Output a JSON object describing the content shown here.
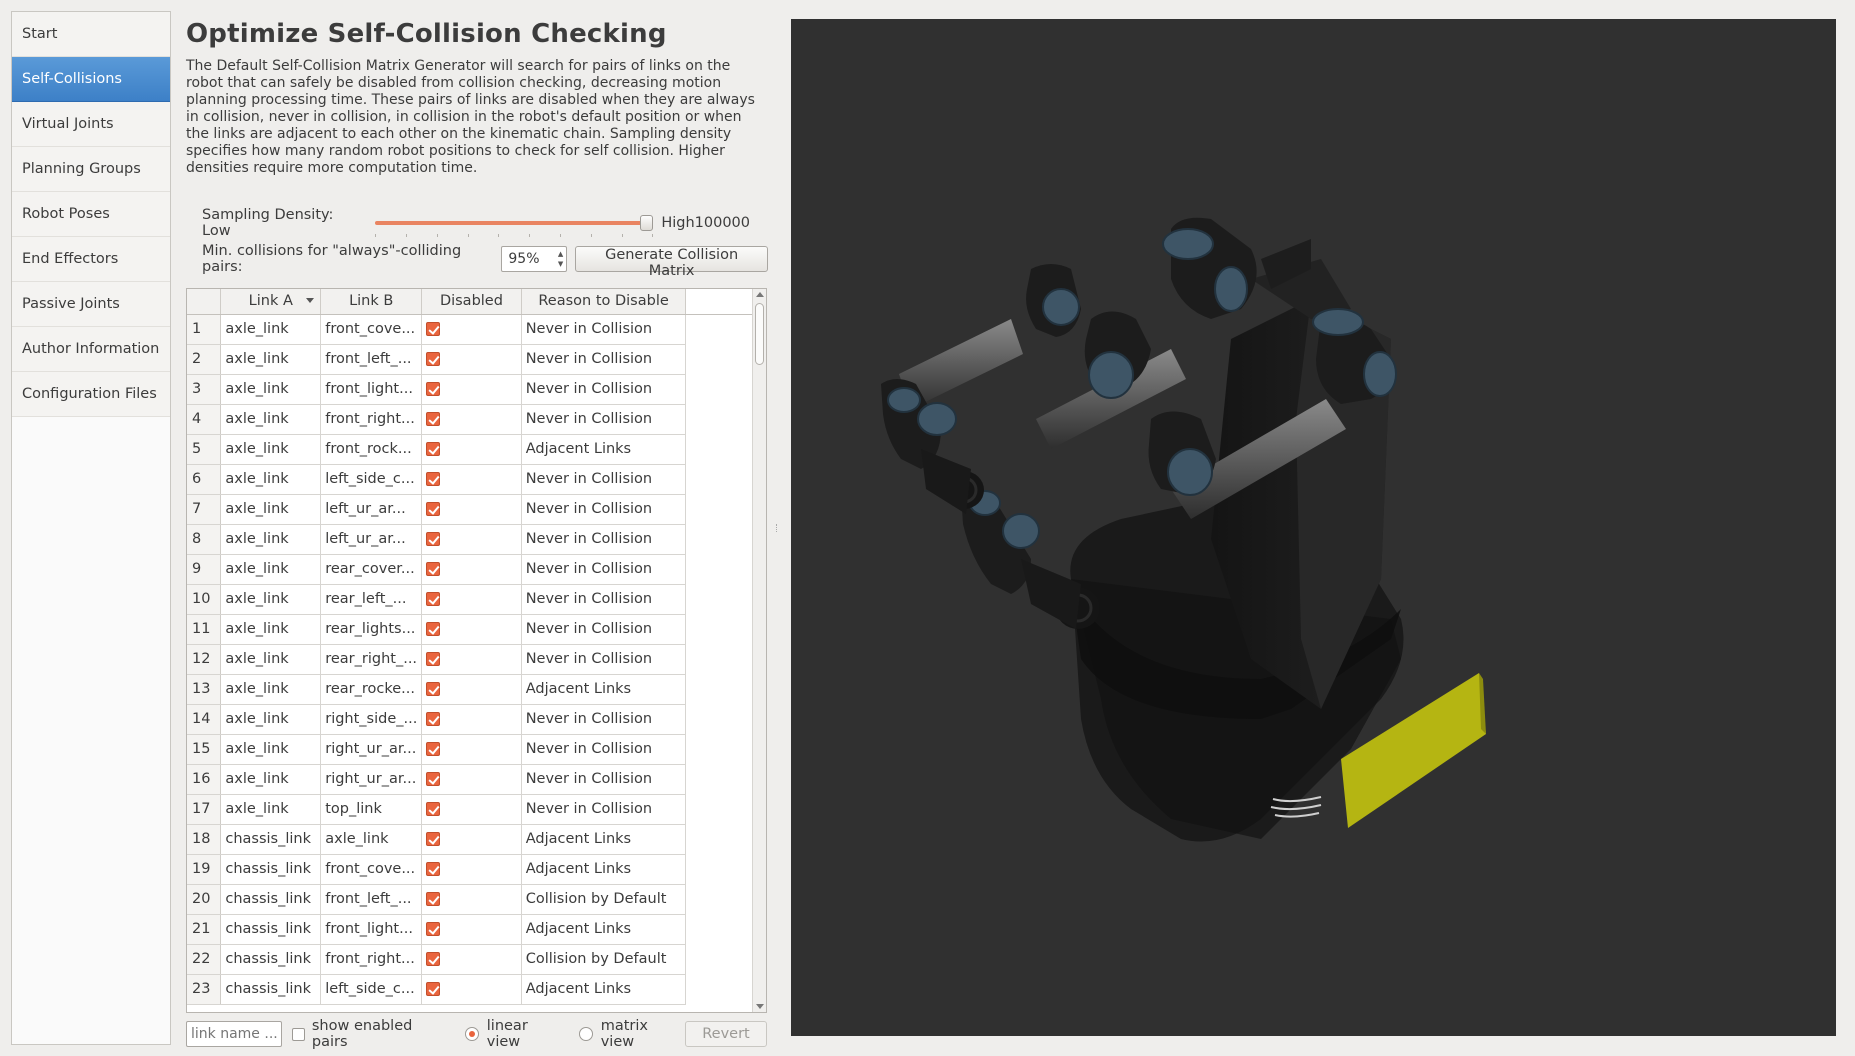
{
  "sidebar": {
    "items": [
      {
        "label": "Start"
      },
      {
        "label": "Self-Collisions"
      },
      {
        "label": "Virtual Joints"
      },
      {
        "label": "Planning Groups"
      },
      {
        "label": "Robot Poses"
      },
      {
        "label": "End Effectors"
      },
      {
        "label": "Passive Joints"
      },
      {
        "label": "Author Information"
      },
      {
        "label": "Configuration Files"
      }
    ],
    "active": "Self-Collisions"
  },
  "main": {
    "title": "Optimize Self-Collision Checking",
    "description": "The Default Self-Collision Matrix Generator will search for pairs of links on the robot that can safely be disabled from collision checking, decreasing motion planning processing time. These pairs of links are disabled when they are always in collision, never in collision, in collision in the robot's default position or when the links are adjacent to each other on the kinematic chain. Sampling density specifies how many random robot positions to check for self collision. Higher densities require more computation time.",
    "density": {
      "label": "Sampling Density: Low",
      "high_label": "High",
      "value": "100000",
      "fraction": 1.0
    },
    "min_collisions": {
      "label": "Min. collisions for \"always\"-colliding pairs:",
      "value": "95%"
    },
    "generate_button": "Generate Collision Matrix",
    "table": {
      "headers": [
        "Link A",
        "Link B",
        "Disabled",
        "Reason to Disable"
      ],
      "rows": [
        {
          "n": "1",
          "a": "axle_link",
          "b": "front_cove...",
          "disabled": true,
          "reason": "Never in Collision"
        },
        {
          "n": "2",
          "a": "axle_link",
          "b": "front_left_...",
          "disabled": true,
          "reason": "Never in Collision"
        },
        {
          "n": "3",
          "a": "axle_link",
          "b": "front_light...",
          "disabled": true,
          "reason": "Never in Collision"
        },
        {
          "n": "4",
          "a": "axle_link",
          "b": "front_right...",
          "disabled": true,
          "reason": "Never in Collision"
        },
        {
          "n": "5",
          "a": "axle_link",
          "b": "front_rock...",
          "disabled": true,
          "reason": "Adjacent Links"
        },
        {
          "n": "6",
          "a": "axle_link",
          "b": "left_side_c...",
          "disabled": true,
          "reason": "Never in Collision"
        },
        {
          "n": "7",
          "a": "axle_link",
          "b": "left_ur_ar...",
          "disabled": true,
          "reason": "Never in Collision"
        },
        {
          "n": "8",
          "a": "axle_link",
          "b": "left_ur_ar...",
          "disabled": true,
          "reason": "Never in Collision"
        },
        {
          "n": "9",
          "a": "axle_link",
          "b": "rear_cover...",
          "disabled": true,
          "reason": "Never in Collision"
        },
        {
          "n": "10",
          "a": "axle_link",
          "b": "rear_left_...",
          "disabled": true,
          "reason": "Never in Collision"
        },
        {
          "n": "11",
          "a": "axle_link",
          "b": "rear_lights...",
          "disabled": true,
          "reason": "Never in Collision"
        },
        {
          "n": "12",
          "a": "axle_link",
          "b": "rear_right_...",
          "disabled": true,
          "reason": "Never in Collision"
        },
        {
          "n": "13",
          "a": "axle_link",
          "b": "rear_rocke...",
          "disabled": true,
          "reason": "Adjacent Links"
        },
        {
          "n": "14",
          "a": "axle_link",
          "b": "right_side_...",
          "disabled": true,
          "reason": "Never in Collision"
        },
        {
          "n": "15",
          "a": "axle_link",
          "b": "right_ur_ar...",
          "disabled": true,
          "reason": "Never in Collision"
        },
        {
          "n": "16",
          "a": "axle_link",
          "b": "right_ur_ar...",
          "disabled": true,
          "reason": "Never in Collision"
        },
        {
          "n": "17",
          "a": "axle_link",
          "b": "top_link",
          "disabled": true,
          "reason": "Never in Collision"
        },
        {
          "n": "18",
          "a": "chassis_link",
          "b": "axle_link",
          "disabled": true,
          "reason": "Adjacent Links"
        },
        {
          "n": "19",
          "a": "chassis_link",
          "b": "front_cove...",
          "disabled": true,
          "reason": "Adjacent Links"
        },
        {
          "n": "20",
          "a": "chassis_link",
          "b": "front_left_...",
          "disabled": true,
          "reason": "Collision by Default"
        },
        {
          "n": "21",
          "a": "chassis_link",
          "b": "front_light...",
          "disabled": true,
          "reason": "Adjacent Links"
        },
        {
          "n": "22",
          "a": "chassis_link",
          "b": "front_right...",
          "disabled": true,
          "reason": "Collision by Default"
        },
        {
          "n": "23",
          "a": "chassis_link",
          "b": "left_side_c...",
          "disabled": true,
          "reason": "Adjacent Links"
        }
      ]
    },
    "bottom": {
      "filter_placeholder": "link name ...",
      "show_enabled_label": "show enabled pairs",
      "linear_label": "linear view",
      "matrix_label": "matrix view",
      "revert_label": "Revert",
      "view_mode": "linear"
    }
  },
  "viewport": {
    "background": "#303030",
    "accent_yellow": "#b5b512",
    "joint_blue": "#3e5566"
  }
}
